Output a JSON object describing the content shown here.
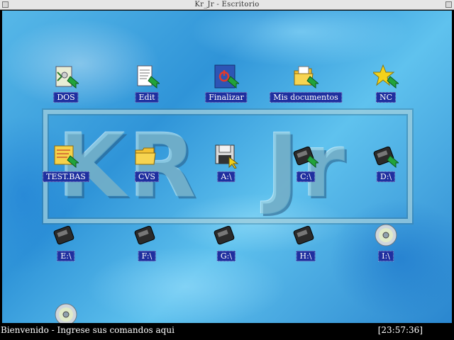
{
  "window": {
    "title": "Kr_Jr - Escritorio"
  },
  "desktop": {
    "watermark": "KR  Jr",
    "icons": [
      {
        "id": "dos",
        "label": "DOS",
        "icon": "dos-program-icon"
      },
      {
        "id": "edit",
        "label": "Edit",
        "icon": "edit-document-icon"
      },
      {
        "id": "finalizar",
        "label": "Finalizar",
        "icon": "shutdown-icon"
      },
      {
        "id": "mis-documentos",
        "label": "Mis documentos",
        "icon": "folder-documents-icon"
      },
      {
        "id": "nc",
        "label": "NC",
        "icon": "star-icon"
      },
      {
        "id": "test-bas",
        "label": "TEST.BAS",
        "icon": "basic-file-icon"
      },
      {
        "id": "cvs",
        "label": "CVS",
        "icon": "folder-icon"
      },
      {
        "id": "a",
        "label": "A:\\",
        "icon": "floppy-drive-icon"
      },
      {
        "id": "c",
        "label": "C:\\",
        "icon": "hard-drive-icon"
      },
      {
        "id": "d",
        "label": "D:\\",
        "icon": "hard-drive-icon"
      },
      {
        "id": "e",
        "label": "E:\\",
        "icon": "hard-drive-icon"
      },
      {
        "id": "f",
        "label": "F:\\",
        "icon": "hard-drive-icon"
      },
      {
        "id": "g",
        "label": "G:\\",
        "icon": "hard-drive-icon"
      },
      {
        "id": "h",
        "label": "H:\\",
        "icon": "hard-drive-icon"
      },
      {
        "id": "i",
        "label": "I:\\",
        "icon": "cd-rom-icon"
      },
      {
        "id": "cd-extra",
        "label": "",
        "icon": "cd-rom-icon"
      }
    ]
  },
  "statusbar": {
    "message": "Bienvenido - Ingrese sus comandos aqui",
    "clock": "[23:57:36]"
  },
  "colors": {
    "label_bg": "#1f2f9f",
    "status_bg": "#000000",
    "title_bg": "#e6e6e6"
  }
}
